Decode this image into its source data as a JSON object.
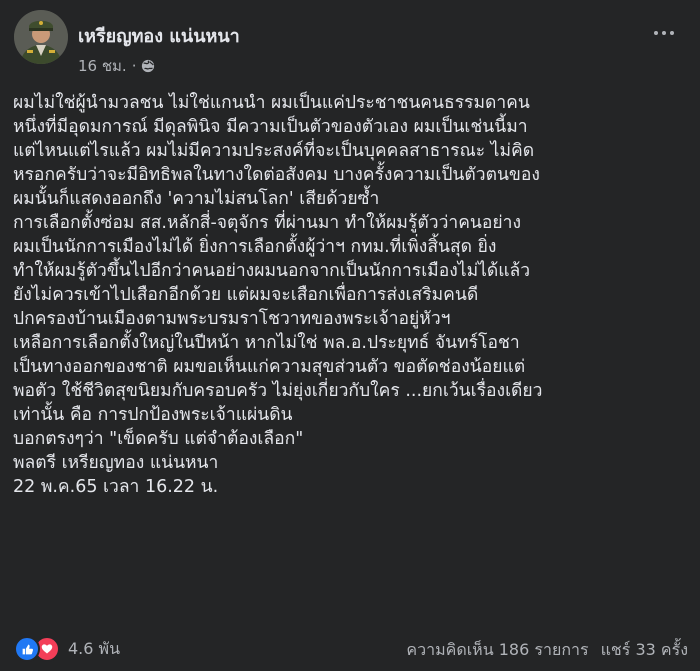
{
  "post": {
    "author": "เหรียญทอง แน่นหนา",
    "time": "16 ชม.",
    "separator": "·",
    "privacy_icon": "globe-icon",
    "more_icon": "more-options-icon",
    "lines": [
      "ผมไม่ใช่ผู้นำมวลชน ไม่ใช่แกนนำ ผมเป็นแค่ประชาชนคนธรรมดาคน",
      "หนึ่งที่มีอุดมการณ์ มีดุลพินิจ มีความเป็นตัวของตัวเอง ผมเป็นเช่นนี้มา",
      "แต่ไหนแต่ไรแล้ว ผมไม่มีความประสงค์ที่จะเป็นบุคคลสาธารณะ ไม่คิด",
      "หรอกครับว่าจะมีอิทธิพลในทางใดต่อสังคม บางครั้งความเป็นตัวตนของ",
      "ผมนั้นก็แสดงออกถึง 'ความไม่สนโลก' เสียด้วยซ้ำ",
      "การเลือกตั้งซ่อม สส.หลักสี่-จตุจักร ที่ผ่านมา ทำให้ผมรู้ตัวว่าคนอย่าง",
      "ผมเป็นนักการเมืองไม่ได้ ยิ่งการเลือกตั้งผู้ว่าฯ กทม.ที่เพิ่งสิ้นสุด ยิ่ง",
      "ทำให้ผมรู้ตัวขึ้นไปอีกว่าคนอย่างผมนอกจากเป็นนักการเมืองไม่ได้แล้ว",
      "ยังไม่ควรเข้าไปเสือกอีกด้วย แต่ผมจะเสือกเพื่อการส่งเสริมคนดี",
      "ปกครองบ้านเมืองตามพระบรมราโชวาทของพระเจ้าอยู่หัวฯ",
      "เหลือการเลือกตั้งใหญ่ในปีหน้า หากไม่ใช่ พล.อ.ประยุทธ์ จันทร์โอชา",
      "เป็นทางออกของชาติ ผมขอเห็นแก่ความสุขส่วนตัว ขอตัดช่องน้อยแต่",
      "พอตัว ใช้ชีวิตสุขนิยมกับครอบครัว ไม่ยุ่งเกี่ยวกับใคร ...ยกเว้นเรื่องเดียว",
      "เท่านั้น คือ การปกป้องพระเจ้าแผ่นดิน",
      "บอกตรงๆว่า \"เข็ดครับ แต่จำต้องเลือก\"",
      "พลตรี เหรียญทอง แน่นหนา",
      "22 พ.ค.65 เวลา 16.22 น."
    ]
  },
  "footer": {
    "reaction_icons": [
      "like-icon",
      "love-icon"
    ],
    "reaction_count": "4.6 พัน",
    "comments": "ความคิดเห็น 186 รายการ",
    "shares": "แชร์ 33 ครั้ง"
  },
  "colors": {
    "background": "#242526",
    "text": "#e4e6eb",
    "secondary_text": "#b0b3b8",
    "like_blue": "#2078f4",
    "love_red": "#f33e58"
  }
}
